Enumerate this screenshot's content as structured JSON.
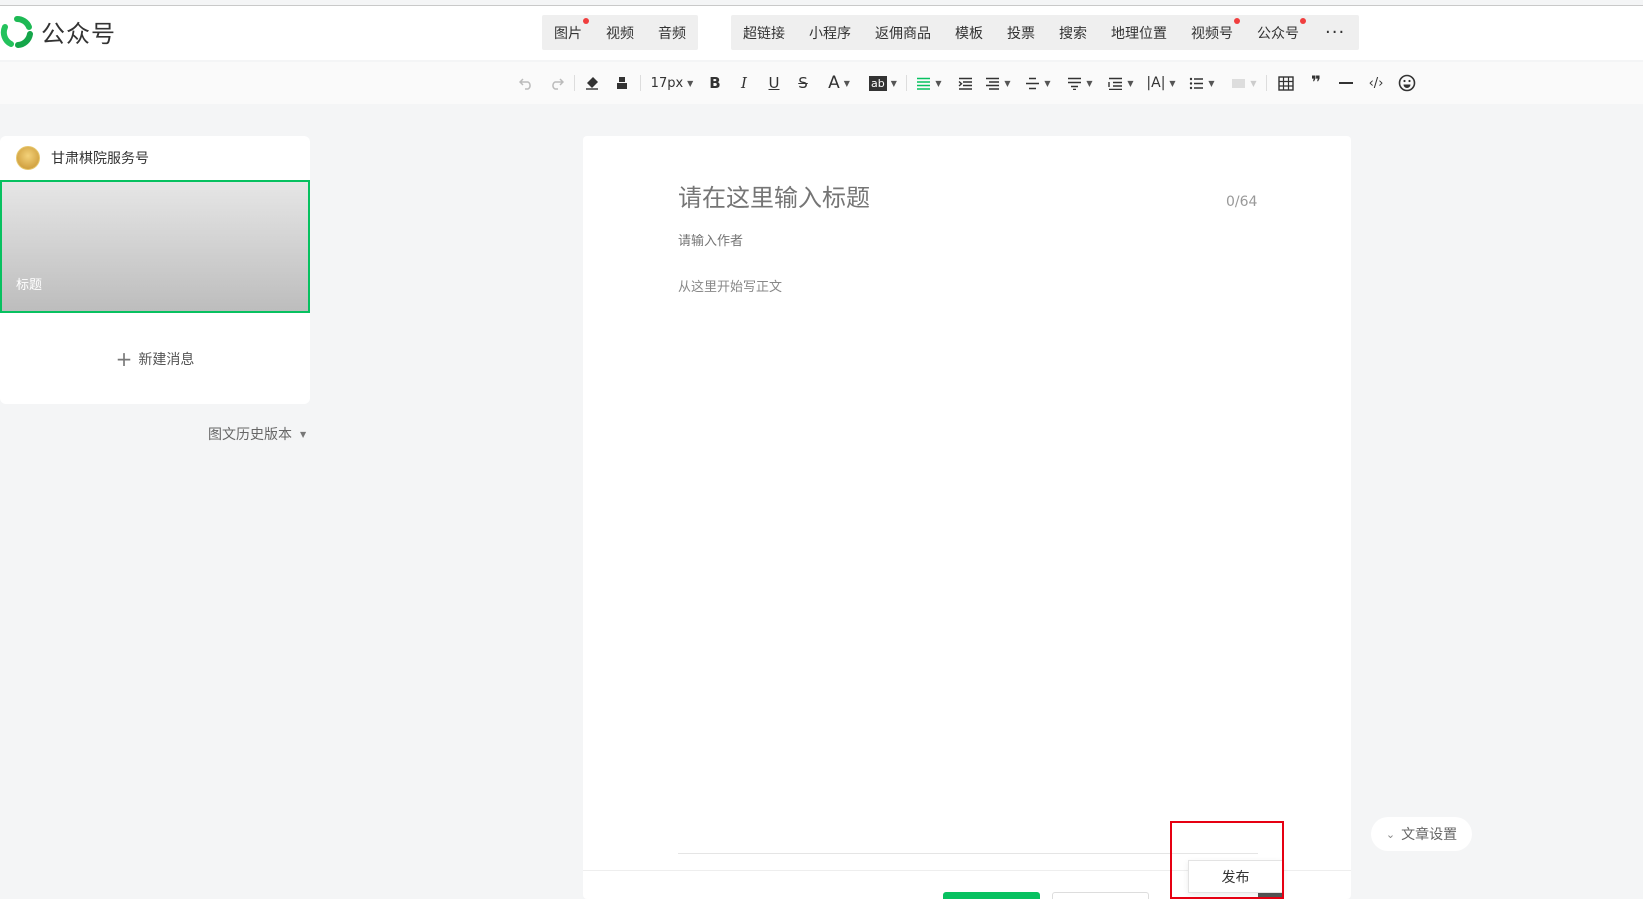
{
  "header": {
    "app_name": "公众号",
    "insert_media": [
      {
        "label": "图片",
        "dot": true
      },
      {
        "label": "视频",
        "dot": false
      },
      {
        "label": "音频",
        "dot": false
      }
    ],
    "insert_content": [
      {
        "label": "超链接",
        "dot": false
      },
      {
        "label": "小程序",
        "dot": false
      },
      {
        "label": "返佣商品",
        "dot": false
      },
      {
        "label": "模板",
        "dot": false
      },
      {
        "label": "投票",
        "dot": false
      },
      {
        "label": "搜索",
        "dot": false
      },
      {
        "label": "地理位置",
        "dot": false
      },
      {
        "label": "视频号",
        "dot": true
      },
      {
        "label": "公众号",
        "dot": true
      }
    ],
    "more": "···"
  },
  "toolbar": {
    "font_size": "17px",
    "bold": "B",
    "italic": "I",
    "underline": "U",
    "strikethrough": "S",
    "font_color": "A",
    "highlight": "ab"
  },
  "sidebar": {
    "account_name": "甘肃棋院服务号",
    "message_title": "标题",
    "new_message": "新建消息",
    "history_versions": "图文历史版本"
  },
  "editor": {
    "title_placeholder": "请在这里输入标题",
    "title_count": "0/64",
    "author_placeholder": "请输入作者",
    "body_placeholder": "从这里开始写正文"
  },
  "footer": {
    "publish_label": "发布",
    "article_settings": "文章设置"
  },
  "colors": {
    "accent": "#07c160",
    "dot": "#f03e3e",
    "highlight_box": "#e60012"
  }
}
